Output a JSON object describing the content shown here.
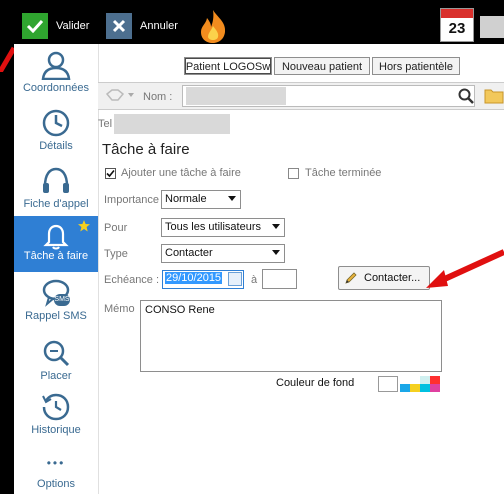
{
  "toolbar": {
    "validate_label": "Valider",
    "cancel_label": "Annuler",
    "calendar_day": "23"
  },
  "sidebar": {
    "items": [
      {
        "label": "Coordonnées",
        "icon": "person-icon"
      },
      {
        "label": "Détails",
        "icon": "clock-icon"
      },
      {
        "label": "Fiche d'appel",
        "icon": "headset-icon"
      },
      {
        "label": "Tâche à faire",
        "icon": "bell-icon",
        "active": true
      },
      {
        "label": "Rappel SMS",
        "icon": "sms-icon",
        "sms_text": "SMS"
      },
      {
        "label": "Placer",
        "icon": "magnifier-icon"
      },
      {
        "label": "Historique",
        "icon": "history-icon"
      },
      {
        "label": "Options",
        "icon": "dots-icon",
        "dots": "•••"
      }
    ]
  },
  "tabs": [
    "Patient LOGOSw",
    "Nouveau patient",
    "Hors patientèle"
  ],
  "search": {
    "name_label": "Nom :",
    "tel_label": "Tel"
  },
  "form": {
    "section_title": "Tâche à faire",
    "add_task_label": "Ajouter une tâche à faire",
    "task_done_label": "Tâche terminée",
    "importance_label": "Importance",
    "importance_value": "Normale",
    "pour_label": "Pour",
    "pour_value": "Tous les utilisateurs",
    "type_label": "Type",
    "type_value": "Contacter",
    "due_label": "Echéance :",
    "due_date": "29/10/2015",
    "at_label": "à",
    "contact_button": "Contacter...",
    "memo_label": "Mémo",
    "memo_value": "CONSO Rene",
    "bg_color_label": "Couleur de fond"
  },
  "colors": {
    "accent": "#2f7fd4",
    "sidebar_text": "#3a6a91",
    "check_green": "#2fa52f",
    "arrow_red": "#e01010"
  }
}
